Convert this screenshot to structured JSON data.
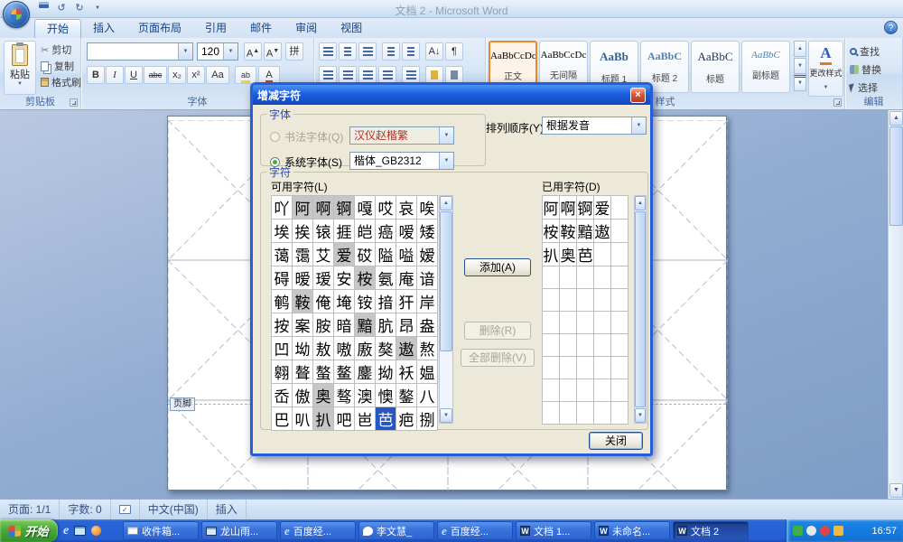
{
  "titlebar": {
    "title": "文档 2 - Microsoft Word"
  },
  "tabs": [
    {
      "label": "开始"
    },
    {
      "label": "插入"
    },
    {
      "label": "页面布局"
    },
    {
      "label": "引用"
    },
    {
      "label": "邮件"
    },
    {
      "label": "审阅"
    },
    {
      "label": "视图"
    }
  ],
  "ribbon": {
    "clipboard": {
      "group_label": "剪贴板",
      "paste": "粘贴",
      "cut": "剪切",
      "copy": "复制",
      "painter": "格式刷"
    },
    "font": {
      "group_label": "字体",
      "font_name_value": "",
      "font_size_value": "120",
      "grow": "A",
      "shrink": "A",
      "phonetic": "拼",
      "char_border": "A",
      "bold": "B",
      "italic": "I",
      "underline": "U",
      "strike": "abc",
      "subscript": "x₂",
      "superscript": "x²",
      "change_case": "Aa",
      "highlight": "ab",
      "font_color": "A"
    },
    "styles": {
      "group_label": "样式",
      "gallery": [
        {
          "preview": "AaBbCcDc",
          "name": "正文"
        },
        {
          "preview": "AaBbCcDc",
          "name": "无间隔"
        },
        {
          "preview": "AaBb",
          "name": "标题 1"
        },
        {
          "preview": "AaBbC",
          "name": "标题 2"
        },
        {
          "preview": "AaBbC",
          "name": "标题"
        },
        {
          "preview": "AaBbC",
          "name": "副标题"
        }
      ],
      "change_styles": "更改样式"
    },
    "editing": {
      "group_label": "编辑",
      "find": "查找",
      "replace": "替换",
      "select": "选择"
    }
  },
  "document": {
    "footer_tag": "页脚"
  },
  "dialog": {
    "title": "增减字符",
    "font_section": {
      "label": "字体",
      "calligraphy_radio": "书法字体(Q)",
      "calligraphy_value": "汉仪赵楷繁",
      "system_radio": "系统字体(S)",
      "system_value": "楷体_GB2312",
      "sort_label": "排列顺序(Y):",
      "sort_value": "根据发音"
    },
    "char_section": {
      "label": "字符",
      "available_label": "可用字符(L)",
      "used_label": "已用字符(D)",
      "add_button": "添加(A)",
      "remove_button": "删除(R)",
      "remove_all_button": "全部删除(V)",
      "selected": "芭",
      "added": [
        "阿",
        "啊",
        "锕",
        "爱",
        "桉",
        "鞍",
        "黯",
        "遨",
        "奥",
        "扒"
      ],
      "available": [
        [
          "吖",
          "阿",
          "啊",
          "锕",
          "嘎",
          "哎",
          "哀",
          "唉"
        ],
        [
          "埃",
          "挨",
          "锿",
          "捱",
          "皑",
          "癌",
          "嗳",
          "矮"
        ],
        [
          "蔼",
          "霭",
          "艾",
          "爱",
          "砹",
          "隘",
          "嗌",
          "嫒"
        ],
        [
          "碍",
          "暧",
          "瑷",
          "安",
          "桉",
          "氨",
          "庵",
          "谙"
        ],
        [
          "鹌",
          "鞍",
          "俺",
          "埯",
          "铵",
          "揞",
          "犴",
          "岸"
        ],
        [
          "按",
          "案",
          "胺",
          "暗",
          "黯",
          "肮",
          "昂",
          "盎"
        ],
        [
          "凹",
          "坳",
          "敖",
          "嗷",
          "廒",
          "獒",
          "遨",
          "熬"
        ],
        [
          "翱",
          "聱",
          "螯",
          "鳌",
          "鏖",
          "拗",
          "袄",
          "媪"
        ],
        [
          "岙",
          "傲",
          "奥",
          "骜",
          "澳",
          "懊",
          "鏊",
          "八"
        ],
        [
          "巴",
          "叭",
          "扒",
          "吧",
          "岜",
          "芭",
          "疤",
          "捌"
        ]
      ],
      "used": [
        [
          "阿",
          "啊",
          "锕",
          "爱"
        ],
        [
          "桉",
          "鞍",
          "黯",
          "遨"
        ],
        [
          "扒",
          "奥",
          "芭"
        ]
      ]
    },
    "close_button": "关闭"
  },
  "statusbar": {
    "page": "页面: 1/1",
    "words": "字数: 0",
    "language": "中文(中国)",
    "mode": "插入"
  },
  "taskbar": {
    "start": "开始",
    "tasks": [
      {
        "label": "收件箱..."
      },
      {
        "label": "龙山雨..."
      },
      {
        "label": "百度经..."
      },
      {
        "label": "李文慧_"
      },
      {
        "label": "百度经..."
      },
      {
        "label": "文档 1..."
      },
      {
        "label": "未命名..."
      },
      {
        "label": "文档 2"
      }
    ],
    "time": "16:57"
  },
  "icons": {
    "close": "×",
    "dropdown": "▼",
    "up": "▲",
    "down": "▼",
    "more": "▼",
    "undo": "↺",
    "redo": "↻",
    "scissors": "✂",
    "pilcrow": "¶",
    "sort_az": "A↓",
    "help": "?",
    "check": "✓",
    "ie": "e",
    "word": "W"
  }
}
